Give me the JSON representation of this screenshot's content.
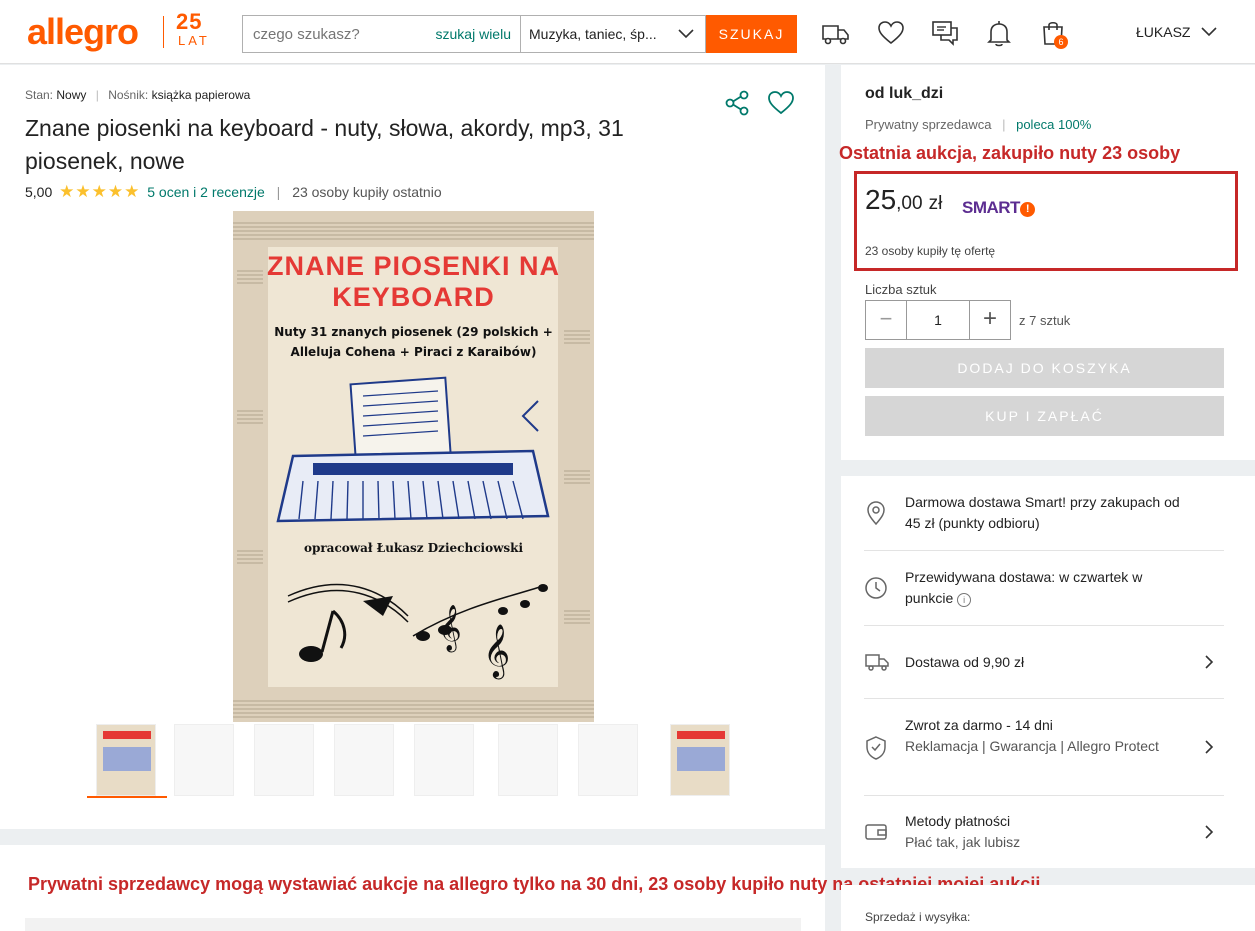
{
  "header": {
    "logo": "allegro",
    "anniversary_number": "25",
    "anniversary_word": "LAT",
    "search_placeholder": "czego szukasz?",
    "search_many": "szukaj wielu",
    "category": "Muzyka, taniec, śp...",
    "search_button": "SZUKAJ",
    "cart_count": "6",
    "user": "ŁUKASZ",
    "icons": [
      "delivery-truck-icon",
      "heart-icon",
      "chat-icon",
      "bell-icon",
      "cart-icon",
      "chevron-down-icon"
    ]
  },
  "product": {
    "condition_label": "Stan:",
    "condition_value": "Nowy",
    "medium_label": "Nośnik:",
    "medium_value": "książka papierowa",
    "title": "Znane piosenki na keyboard - nuty, słowa, akordy, mp3, 31 piosenek, nowe",
    "rating_value": "5,00",
    "stars": 5,
    "reviews_link": "5 ocen i 2 recenzje",
    "recent_buyers": "23 osoby kupiły ostatnio",
    "cover": {
      "title": "ZNANE PIOSENKI NA KEYBOARD",
      "subtitle": "Nuty 31 znanych piosenek (29 polskich + Alleluja Cohena + Piraci z Karaibów)",
      "author": "opracował Łukasz Dziechciowski"
    },
    "thumbnail_count": 8
  },
  "seller": {
    "name": "od luk_dzi",
    "type": "Prywatny sprzedawca",
    "recommend": "poleca 100%"
  },
  "annotations": {
    "top": "Ostatnia aukcja, zakupiło nuty 23 osoby",
    "bottom": "Prywatni sprzedawcy mogą wystawiać aukcje na allegro tylko na 30 dni, 23 osoby kupiło nuty na ostatniej mojej aukcji"
  },
  "offer": {
    "price_int": "25",
    "price_dec": ",00",
    "currency": "zł",
    "smart_label": "SMART",
    "smart_mark": "!",
    "bought": "23 osoby kupiły tę ofertę",
    "qty_label": "Liczba sztuk",
    "qty_value": "1",
    "qty_minus": "−",
    "qty_plus": "+",
    "qty_of": "z 7 sztuk",
    "add_to_cart": "DODAJ DO KOSZYKA",
    "buy_now": "KUP I ZAPŁAĆ"
  },
  "delivery": {
    "free": "Darmowa dostawa Smart! przy zakupach od 45 zł (punkty odbioru)",
    "expected": "Przewidywana dostawa: w czwartek w punkcie",
    "from": "Dostawa od 9,90 zł",
    "return_title": "Zwrot za darmo - 14 dni",
    "return_sub": "Reklamacja | Gwarancja | Allegro Protect",
    "payment_title": "Metody płatności",
    "payment_sub": "Płać tak, jak lubisz",
    "info_icon_text": "i"
  },
  "sales_label": "Sprzedaż i wysyłka:",
  "colors": {
    "accent": "#ff5a00",
    "link": "#00796b",
    "annotation": "#c62828",
    "smart": "#5c2d91"
  }
}
